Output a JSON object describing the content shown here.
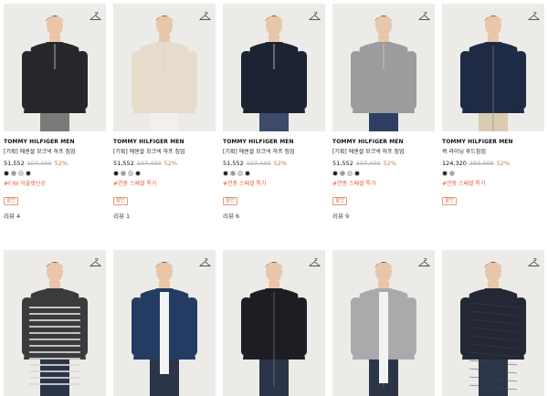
{
  "products_row1": [
    {
      "brand": "TOMMY HILFIGER MEN",
      "name": "[기획] 에센셜 모크넥 하프 집업",
      "sale": "51,552",
      "orig": "107,400",
      "disc": "52%",
      "swatches": [
        "#1a1a1a",
        "#9a9a9a",
        "#d8d2c0",
        "#1b2233"
      ],
      "tag": "#F/W 아울렛신상",
      "badge": "할인",
      "review": "리뷰 4",
      "garment": "#26272a",
      "pants": "#7a7a78",
      "style": "halfzip"
    },
    {
      "brand": "TOMMY HILFIGER MEN",
      "name": "[기획] 에센셜 모크넥 하프 집업",
      "sale": "51,552",
      "orig": "107,400",
      "disc": "52%",
      "swatches": [
        "#1a1a1a",
        "#9a9a9a",
        "#d8d2c0",
        "#1b2233"
      ],
      "tag": "#연중 스페셜 특가",
      "badge": "할인",
      "review": "리뷰 1",
      "garment": "#e6dccb",
      "pants": "#f1f0ec",
      "style": "halfzip"
    },
    {
      "brand": "TOMMY HILFIGER MEN",
      "name": "[기획] 에센셜 모크넥 하프 집업",
      "sale": "51,552",
      "orig": "107,400",
      "disc": "52%",
      "swatches": [
        "#1a1a1a",
        "#9a9a9a",
        "#d8d2c0",
        "#1b2233"
      ],
      "tag": "#연중 스페셜 특가",
      "badge": "할인",
      "review": "리뷰 6",
      "garment": "#1c2333",
      "pants": "#3c4b6a",
      "style": "halfzip"
    },
    {
      "brand": "TOMMY HILFIGER MEN",
      "name": "[기획] 에센셜 모크넥 하프 집업",
      "sale": "51,552",
      "orig": "107,400",
      "disc": "52%",
      "swatches": [
        "#1a1a1a",
        "#9a9a9a",
        "#d8d2c0",
        "#1b2233"
      ],
      "tag": "#연중 스페셜 특가",
      "badge": "할인",
      "review": "리뷰 9",
      "garment": "#9b9c9e",
      "pants": "#2e3f63",
      "style": "halfzip-full"
    },
    {
      "brand": "TOMMY HILFIGER MEN",
      "name": "퀴 라이닝 후드집업",
      "sale": "124,320",
      "orig": "259,000",
      "disc": "52%",
      "swatches": [
        "#1b2233",
        "#a7a7a7"
      ],
      "tag": "#연중 스페셜 특가",
      "badge": "할인",
      "review": "",
      "garment": "#1f2a44",
      "pants": "#d9ccb0",
      "style": "hoodie"
    }
  ],
  "products_row2": [
    {
      "garment": "#3a3b3d",
      "style": "stripe"
    },
    {
      "garment": "#243b63",
      "style": "shirt"
    },
    {
      "garment": "#1c1e24",
      "style": "zipjacket"
    },
    {
      "garment": "#a9aaac",
      "style": "hoodie-grey"
    },
    {
      "garment": "#232834",
      "style": "quilted"
    }
  ],
  "icons": {
    "wishlist": "hanger-icon"
  }
}
